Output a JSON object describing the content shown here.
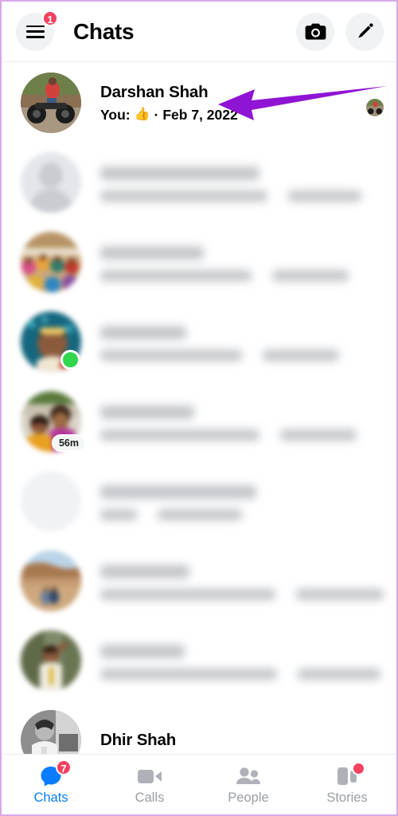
{
  "app": {
    "title": "Chats",
    "accent_blue": "#0a7cff",
    "badge_red": "#f3425f",
    "annotation_purple": "#8f14d4",
    "online_green": "#31d64b"
  },
  "header": {
    "title": "Chats",
    "menu_icon": "hamburger-menu-icon",
    "menu_badge": "1",
    "camera_icon": "camera-icon",
    "compose_icon": "pencil-compose-icon"
  },
  "annotation": {
    "type": "arrow",
    "direction": "left",
    "color": "#8f14d4",
    "points_at": "Darshan Shah"
  },
  "chats": [
    {
      "name": "Darshan Shah",
      "preview_prefix": "You:",
      "preview_emoji": "👍",
      "separator": "·",
      "timestamp": "Feb 7, 2022",
      "blurred": false,
      "avatar_kind": "photo-motorbike",
      "status": "seen",
      "seen_avatar": true
    },
    {
      "name": "",
      "preview_prefix": "",
      "timestamp": "",
      "blurred": true,
      "avatar_kind": "default-person-placeholder",
      "status": "none"
    },
    {
      "name": "",
      "preview_prefix": "",
      "timestamp": "",
      "blurred": true,
      "avatar_kind": "photo-group",
      "status": "none"
    },
    {
      "name": "",
      "preview_prefix": "",
      "timestamp": "",
      "blurred": true,
      "avatar_kind": "photo-groom",
      "status": "online"
    },
    {
      "name": "",
      "preview_prefix": "",
      "timestamp": "",
      "blurred": true,
      "avatar_kind": "photo-couple",
      "status": "last-active",
      "last_active": "56m"
    },
    {
      "name": "",
      "preview_prefix": "",
      "timestamp": "",
      "blurred": true,
      "avatar_kind": "empty-grey",
      "status": "none"
    },
    {
      "name": "",
      "preview_prefix": "",
      "timestamp": "",
      "blurred": true,
      "avatar_kind": "photo-canyon",
      "status": "none"
    },
    {
      "name": "",
      "preview_prefix": "",
      "timestamp": "",
      "blurred": true,
      "avatar_kind": "photo-hiker",
      "status": "none"
    },
    {
      "name": "Dhir Shah",
      "preview_prefix": "",
      "timestamp": "",
      "blurred": false,
      "avatar_kind": "photo-bw-portrait",
      "status": "none"
    }
  ],
  "bottom_nav": [
    {
      "label": "Chats",
      "icon": "chat-bubble-icon",
      "active": true,
      "badge": "7",
      "dot": false
    },
    {
      "label": "Calls",
      "icon": "video-camera-icon",
      "active": false,
      "badge": "",
      "dot": false
    },
    {
      "label": "People",
      "icon": "people-icon",
      "active": false,
      "badge": "",
      "dot": false
    },
    {
      "label": "Stories",
      "icon": "stories-icon",
      "active": false,
      "badge": "",
      "dot": true
    }
  ]
}
